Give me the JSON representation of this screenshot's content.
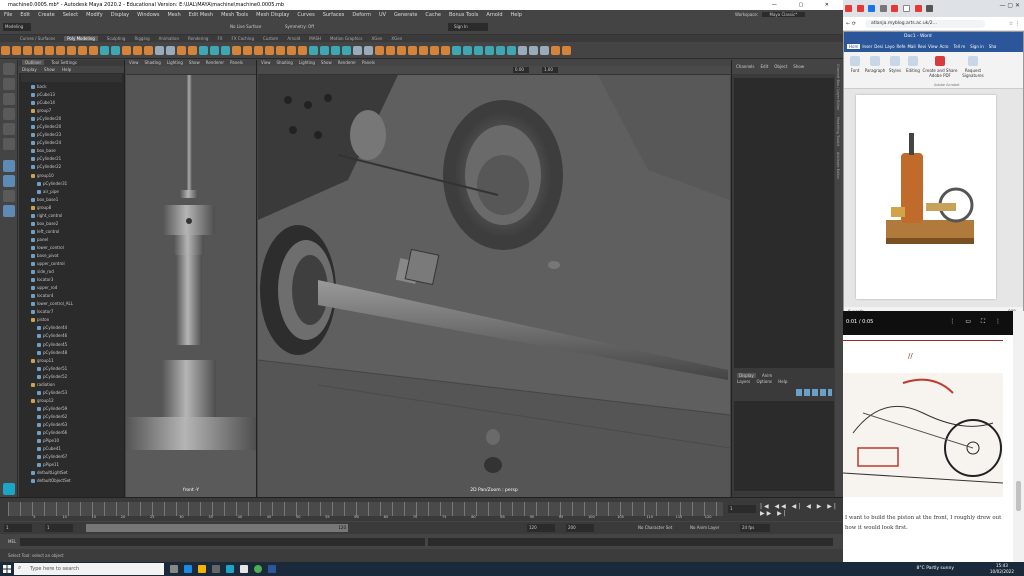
{
  "maya": {
    "title": "machine0.0005.mb* - Autodesk Maya 2020.2 - Educational Version: E:\\UAL\\MAYA\\machine\\machine0.0005.mb",
    "menu": [
      "File",
      "Edit",
      "Create",
      "Select",
      "Modify",
      "Display",
      "Windows",
      "Mesh",
      "Edit Mesh",
      "Mesh Tools",
      "Mesh Display",
      "Curves",
      "Surfaces",
      "Deform",
      "UV",
      "Generate",
      "Cache",
      "Bonus Tools",
      "Arnold",
      "Help"
    ],
    "workspace_label": "Workspace:",
    "workspace_value": "Maya Classic*",
    "mode_select": "Modeling",
    "no_live_surface": "No Live Surface",
    "symmetry": "Symmetry: Off",
    "sign_in": "Sign In",
    "shelf_tabs": [
      "Curves / Surfaces",
      "Poly Modeling",
      "Sculpting",
      "Rigging",
      "Animation",
      "Rendering",
      "FX",
      "FX Caching",
      "Custom",
      "Arnold",
      "MASH",
      "Motion Graphics",
      "XGen",
      "XGen"
    ],
    "active_shelf": "Poly Modeling",
    "outliner": {
      "tabs": [
        "Outliner",
        "Tool Settings"
      ],
      "menu": [
        "Display",
        "Show",
        "Help"
      ],
      "items": [
        {
          "name": "back",
          "group": false,
          "indent": false
        },
        {
          "name": "pCube13",
          "group": false,
          "indent": false
        },
        {
          "name": "pCube14",
          "group": false,
          "indent": false
        },
        {
          "name": "group7",
          "group": true,
          "indent": false
        },
        {
          "name": "pCylinder20",
          "group": false,
          "indent": false
        },
        {
          "name": "pCylinder20",
          "group": false,
          "indent": false
        },
        {
          "name": "pCylinder23",
          "group": false,
          "indent": false
        },
        {
          "name": "pCylinder24",
          "group": false,
          "indent": false
        },
        {
          "name": "box_base",
          "group": false,
          "indent": false
        },
        {
          "name": "pCylinder21",
          "group": false,
          "indent": false
        },
        {
          "name": "pCylinder22",
          "group": false,
          "indent": false
        },
        {
          "name": "group10",
          "group": true,
          "indent": false
        },
        {
          "name": "pCylinder31",
          "group": false,
          "indent": true
        },
        {
          "name": "air_pipe",
          "group": false,
          "indent": true
        },
        {
          "name": "box_base1",
          "group": false,
          "indent": false
        },
        {
          "name": "group8",
          "group": true,
          "indent": false
        },
        {
          "name": "right_control",
          "group": false,
          "indent": false
        },
        {
          "name": "box_base2",
          "group": false,
          "indent": false
        },
        {
          "name": "left_control",
          "group": false,
          "indent": false
        },
        {
          "name": "panel",
          "group": false,
          "indent": false
        },
        {
          "name": "lower_control",
          "group": false,
          "indent": false
        },
        {
          "name": "base_pivot",
          "group": false,
          "indent": false
        },
        {
          "name": "upper_control",
          "group": false,
          "indent": false
        },
        {
          "name": "side_rod",
          "group": false,
          "indent": false
        },
        {
          "name": "locator3",
          "group": false,
          "indent": false
        },
        {
          "name": "upper_rod",
          "group": false,
          "indent": false
        },
        {
          "name": "locator4",
          "group": false,
          "indent": false
        },
        {
          "name": "lower_control_ALL",
          "group": false,
          "indent": false
        },
        {
          "name": "locator7",
          "group": false,
          "indent": false
        },
        {
          "name": "piston",
          "group": true,
          "indent": false
        },
        {
          "name": "pCylinder44",
          "group": false,
          "indent": true
        },
        {
          "name": "pCylinder46",
          "group": false,
          "indent": true
        },
        {
          "name": "pCylinder45",
          "group": false,
          "indent": true
        },
        {
          "name": "pCylinder48",
          "group": false,
          "indent": true
        },
        {
          "name": "group11",
          "group": true,
          "indent": false
        },
        {
          "name": "pCylinder51",
          "group": false,
          "indent": true
        },
        {
          "name": "pCylinder52",
          "group": false,
          "indent": true
        },
        {
          "name": "radiation",
          "group": true,
          "indent": false
        },
        {
          "name": "pCylinder53",
          "group": false,
          "indent": true
        },
        {
          "name": "group12",
          "group": true,
          "indent": false
        },
        {
          "name": "pCylinder59",
          "group": false,
          "indent": true
        },
        {
          "name": "pCylinder62",
          "group": false,
          "indent": true
        },
        {
          "name": "pCylinder63",
          "group": false,
          "indent": true
        },
        {
          "name": "pCylinder66",
          "group": false,
          "indent": true
        },
        {
          "name": "pPipe10",
          "group": false,
          "indent": true
        },
        {
          "name": "pCube41",
          "group": false,
          "indent": true
        },
        {
          "name": "pCylinder67",
          "group": false,
          "indent": true
        },
        {
          "name": "pPipe11",
          "group": false,
          "indent": true
        },
        {
          "name": "defaultLightSet",
          "group": false,
          "indent": false
        },
        {
          "name": "defaultObjectSet",
          "group": false,
          "indent": false
        }
      ]
    },
    "viewport_menu": [
      "View",
      "Shading",
      "Lighting",
      "Show",
      "Renderer",
      "Panels"
    ],
    "viewport1_label": "front -Y",
    "viewport2_label": "2D Pan/Zoom : persp",
    "vp_field1": "0.00",
    "vp_field2": "1.00",
    "channel_tabs": [
      "Channels",
      "Edit",
      "Object",
      "Show"
    ],
    "layer_tabs": [
      "Display",
      "Anim"
    ],
    "layer_menu": [
      "Layers",
      "Options",
      "Help"
    ],
    "side_tabs": [
      "Channel Box / Layer Editor",
      "Modelling Toolkit",
      "Attribute Editor"
    ],
    "time": {
      "ticks": [
        "5",
        "10",
        "15",
        "20",
        "25",
        "30",
        "35",
        "40",
        "45",
        "50",
        "55",
        "60",
        "65",
        "70",
        "75",
        "80",
        "85",
        "90",
        "95",
        "100",
        "105",
        "110",
        "115",
        "120"
      ],
      "current_frame": "1",
      "range_start": "1",
      "range_start2": "1",
      "range_display": "120",
      "range_end": "120",
      "range_end2": "200",
      "fps": "24 fps",
      "char_set": "No Character Set",
      "anim_layer": "No Anim Layer"
    },
    "cmd_label": "MEL",
    "help_text": "Select Tool: select an object"
  },
  "browser": {
    "url": "atlanja.myblog.arts.ac.uk/2...",
    "word_title": "Doc1 - Word",
    "word_tabs": [
      "Hom",
      "Inser",
      "Desi",
      "Layo",
      "Refe",
      "Mail",
      "Revi",
      "View",
      "Acro"
    ],
    "tell_me": "Tell m",
    "word_signin": "Sign in",
    "word_share": "Sha",
    "ribbon": {
      "font": "Font",
      "paragraph": "Paragraph",
      "styles": "Styles",
      "editing": "Editing",
      "create_share": "Create and Share Adobe PDF",
      "request_sig": "Request Signatures",
      "group_caption": "Adobe Acrobat"
    },
    "word_status": "0 words",
    "zoom": "90%",
    "video_time": "0:01 / 0:05",
    "blog_separator": "//",
    "blog_text": "I want to build the piston at the front, I roughly drew out how it would look first."
  },
  "taskbar": {
    "search_placeholder": "Type here to search",
    "weather": "8°C  Partly sunny",
    "time": "15:43",
    "date": "10/02/2022"
  }
}
